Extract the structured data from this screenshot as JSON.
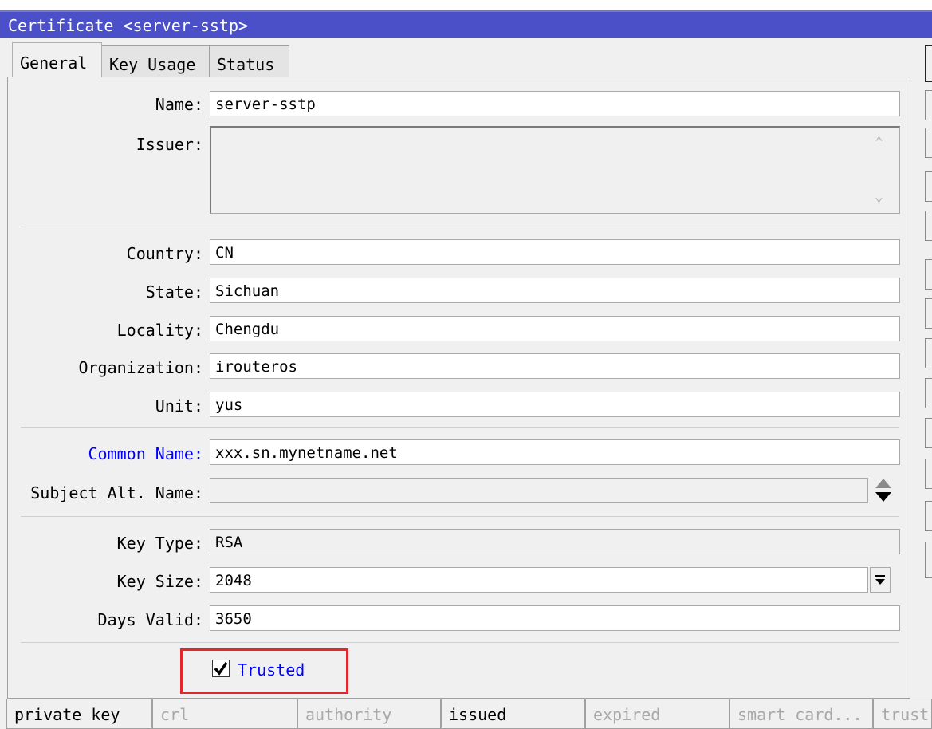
{
  "window": {
    "title": "Certificate <server-sstp>"
  },
  "tabs": [
    "General",
    "Key Usage",
    "Status"
  ],
  "fields": {
    "name": {
      "label": "Name:",
      "value": "server-sstp"
    },
    "issuer": {
      "label": "Issuer:",
      "value": ""
    },
    "country": {
      "label": "Country:",
      "value": "CN"
    },
    "state": {
      "label": "State:",
      "value": "Sichuan"
    },
    "locality": {
      "label": "Locality:",
      "value": "Chengdu"
    },
    "organization": {
      "label": "Organization:",
      "value": "irouteros"
    },
    "unit": {
      "label": "Unit:",
      "value": "yus"
    },
    "common_name": {
      "label": "Common Name:",
      "value": "xxx.sn.mynetname.net"
    },
    "subject_alt_name": {
      "label": "Subject Alt. Name:",
      "value": ""
    },
    "key_type": {
      "label": "Key Type:",
      "value": "RSA"
    },
    "key_size": {
      "label": "Key Size:",
      "value": "2048"
    },
    "days_valid": {
      "label": "Days Valid:",
      "value": "3650"
    }
  },
  "trusted": {
    "label": "Trusted",
    "checked": true
  },
  "status_bar": [
    {
      "label": "private key",
      "active": true
    },
    {
      "label": "crl",
      "active": false
    },
    {
      "label": "authority",
      "active": false
    },
    {
      "label": "issued",
      "active": true
    },
    {
      "label": "expired",
      "active": false
    },
    {
      "label": "smart card...",
      "active": false
    },
    {
      "label": "trust",
      "active": false
    }
  ],
  "colors": {
    "title_bar": "#4b50c8",
    "highlight_label": "#0000ff",
    "annotation_box": "#e0282e"
  }
}
